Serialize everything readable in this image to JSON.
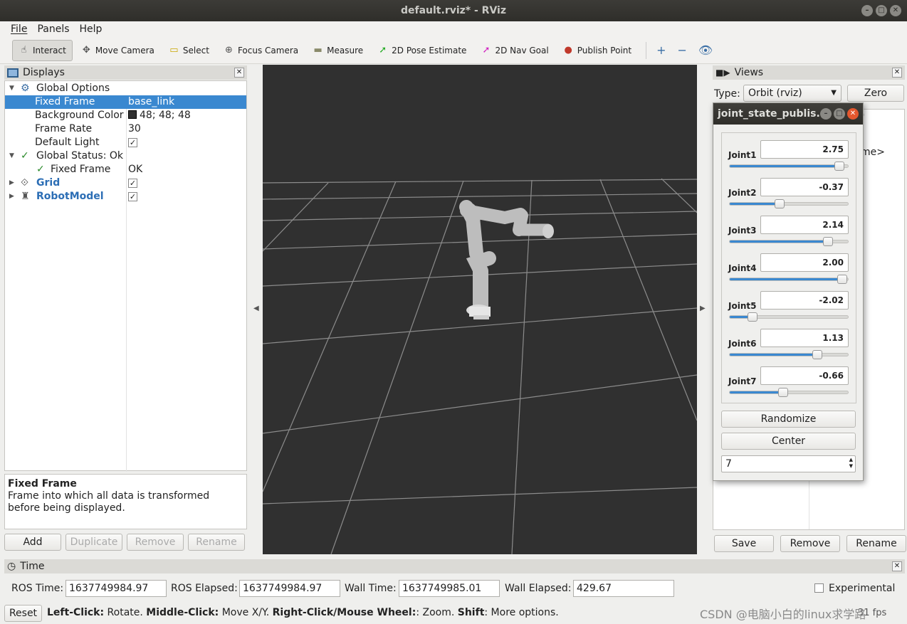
{
  "window": {
    "title": "default.rviz* - RViz"
  },
  "menu": [
    "File",
    "Panels",
    "Help"
  ],
  "toolbar": {
    "tools": [
      {
        "label": "Interact",
        "icon": "hand-icon",
        "glyph": "☝",
        "color": "#333333",
        "active": true
      },
      {
        "label": "Move Camera",
        "icon": "move-camera-icon",
        "glyph": "✥",
        "color": "#555555"
      },
      {
        "label": "Select",
        "icon": "select-icon",
        "glyph": "▭",
        "color": "#c9a800"
      },
      {
        "label": "Focus Camera",
        "icon": "focus-camera-icon",
        "glyph": "⊕",
        "color": "#555555"
      },
      {
        "label": "Measure",
        "icon": "ruler-icon",
        "glyph": "▬",
        "color": "#8a8a6a"
      },
      {
        "label": "2D Pose Estimate",
        "icon": "pose-estimate-icon",
        "glyph": "➚",
        "color": "#22aa22"
      },
      {
        "label": "2D Nav Goal",
        "icon": "nav-goal-icon",
        "glyph": "➚",
        "color": "#d020c0"
      },
      {
        "label": "Publish Point",
        "icon": "publish-point-icon",
        "glyph": "●",
        "color": "#c0392b"
      }
    ],
    "extras": [
      {
        "icon": "plus-icon",
        "glyph": "+"
      },
      {
        "icon": "minus-icon",
        "glyph": "−"
      },
      {
        "icon": "eye-icon",
        "glyph": "👁"
      }
    ]
  },
  "displays": {
    "title": "Displays",
    "rows": [
      {
        "key": "Global Options",
        "value": ""
      },
      {
        "key": "Fixed Frame",
        "value": "base_link"
      },
      {
        "key": "Background Color",
        "value": "48; 48; 48"
      },
      {
        "key": "Frame Rate",
        "value": "30"
      },
      {
        "key": "Default Light",
        "value": "✓"
      },
      {
        "key": "Global Status: Ok",
        "value": ""
      },
      {
        "key": "Fixed Frame",
        "value": "OK"
      },
      {
        "key": "Grid",
        "value": "✓"
      },
      {
        "key": "RobotModel",
        "value": "✓"
      }
    ],
    "bg_color": "#303030",
    "description_title": "Fixed Frame",
    "description_text": "Frame into which all data is transformed before being displayed.",
    "buttons": [
      "Add",
      "Duplicate",
      "Remove",
      "Rename"
    ]
  },
  "views": {
    "title": "Views",
    "type_label": "Type:",
    "type_value": "Orbit (rviz)",
    "zero_label": "Zero",
    "peek_text": "me>",
    "peek_paren": ")",
    "buttons": [
      "Save",
      "Remove",
      "Rename"
    ]
  },
  "joint_publisher": {
    "title": "joint_state_publis...",
    "joints": [
      {
        "name": "Joint1",
        "value": "2.75",
        "fraction": 0.93
      },
      {
        "name": "Joint2",
        "value": "-0.37",
        "fraction": 0.42
      },
      {
        "name": "Joint3",
        "value": "2.14",
        "fraction": 0.83
      },
      {
        "name": "Joint4",
        "value": "2.00",
        "fraction": 0.95
      },
      {
        "name": "Joint5",
        "value": "-2.02",
        "fraction": 0.19
      },
      {
        "name": "Joint6",
        "value": "1.13",
        "fraction": 0.74
      },
      {
        "name": "Joint7",
        "value": "-0.66",
        "fraction": 0.45
      }
    ],
    "randomize_label": "Randomize",
    "center_label": "Center",
    "count_value": "7"
  },
  "time": {
    "title": "Time",
    "ros_time_label": "ROS Time:",
    "ros_time": "1637749984.97",
    "ros_elapsed_label": "ROS Elapsed:",
    "ros_elapsed": "1637749984.97",
    "wall_time_label": "Wall Time:",
    "wall_time": "1637749985.01",
    "wall_elapsed_label": "Wall Elapsed:",
    "wall_elapsed": "429.67",
    "experimental_label": "Experimental"
  },
  "status": {
    "reset_label": "Reset",
    "left_click": "Left-Click:",
    "left_click_desc": " Rotate. ",
    "middle_click": "Middle-Click:",
    "middle_click_desc": " Move X/Y. ",
    "right_click": "Right-Click/Mouse Wheel:",
    "right_click_desc": ": Zoom. ",
    "shift": "Shift",
    "shift_desc": ": More options.",
    "watermark": "CSDN @电脑小白的linux求学路",
    "fps": "31 fps"
  }
}
